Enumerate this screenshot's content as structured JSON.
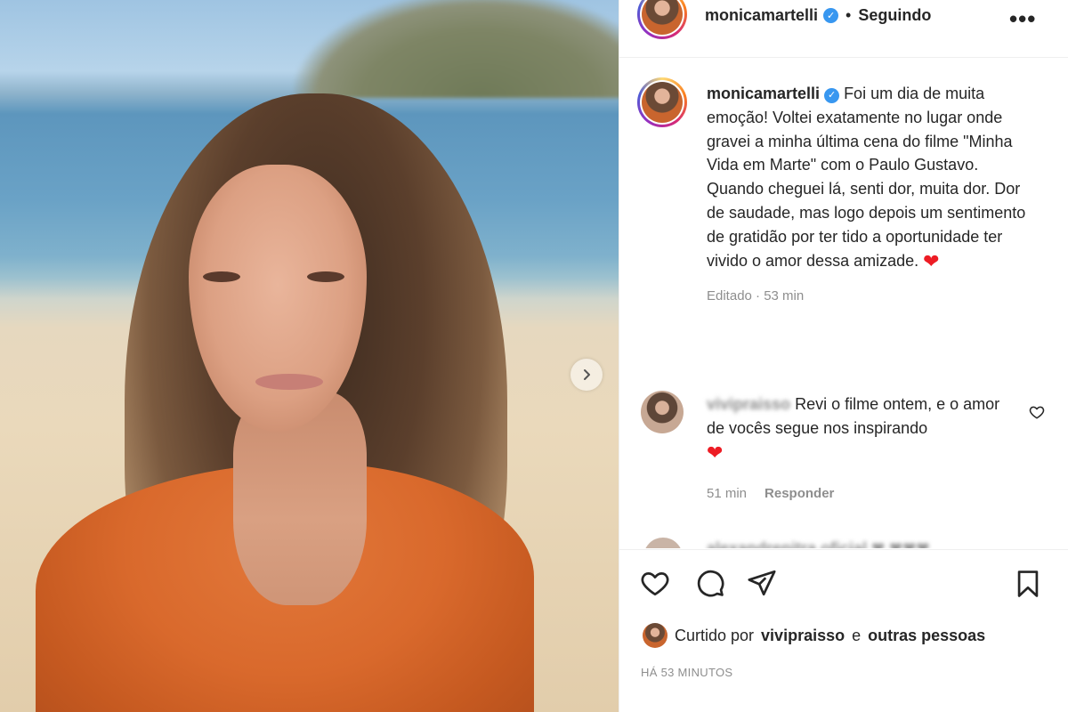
{
  "header": {
    "username": "monicamartelli",
    "separator": "•",
    "follow_status": "Seguindo",
    "more_icon": "more-horizontal-icon"
  },
  "caption": {
    "username": "monicamartelli",
    "text_line1": "Foi um dia de muita emoção! Voltei exatamente no lugar onde gravei a minha última cena do filme \"Minha Vida em Marte\" com o Paulo Gustavo.",
    "text_line2": "Quando cheguei lá, senti dor, muita dor. Dor de saudade, mas logo depois um sentimento de gratidão por ter tido a oportunidade ter vivido o amor dessa amizade.",
    "heart": "❤",
    "edited": "Editado · 53 min"
  },
  "comment": {
    "username": "vivipraisso",
    "text": "Revi o filme ontem, e o amor de vocês segue nos inspirando",
    "heart": "❤",
    "time": "51 min",
    "reply_label": "Responder"
  },
  "peek_comment": {
    "text": "alexandrenitra oficial ❤ ❤❤❤"
  },
  "likes": {
    "prefix": "Curtido por",
    "user": "vivipraisso",
    "conjunction": "e",
    "others": "outras pessoas"
  },
  "timestamp": "HÁ 53 MINUTOS",
  "colors": {
    "verified": "#3897f0",
    "heart": "#ed1c24",
    "muted": "#8e8e8e",
    "text": "#262626"
  }
}
